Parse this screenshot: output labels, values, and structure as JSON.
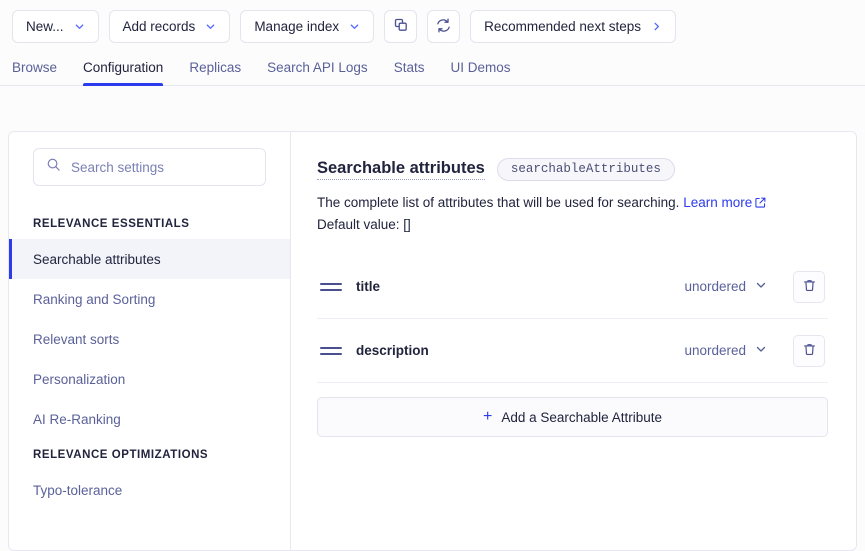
{
  "toolbar": {
    "buttons": [
      {
        "label": "New...",
        "icon": "chevron-down-icon",
        "type": "dropdown"
      },
      {
        "label": "Add records",
        "icon": "chevron-down-icon",
        "type": "dropdown"
      },
      {
        "label": "Manage index",
        "icon": "chevron-down-icon",
        "type": "dropdown"
      }
    ],
    "icon_buttons": [
      {
        "name": "copy-index-icon",
        "title": "Copy"
      },
      {
        "name": "refresh-icon",
        "title": "Refresh"
      }
    ],
    "recommended": {
      "label": "Recommended next steps",
      "icon": "chevron-right-icon"
    }
  },
  "tabs": [
    {
      "label": "Browse",
      "active": false
    },
    {
      "label": "Configuration",
      "active": true
    },
    {
      "label": "Replicas",
      "active": false
    },
    {
      "label": "Search API Logs",
      "active": false
    },
    {
      "label": "Stats",
      "active": false
    },
    {
      "label": "UI Demos",
      "active": false
    }
  ],
  "sidebar": {
    "search": {
      "placeholder": "Search settings",
      "value": "",
      "icon": "search-icon"
    },
    "groups": [
      {
        "heading": "RELEVANCE ESSENTIALS",
        "items": [
          {
            "label": "Searchable attributes",
            "active": true
          },
          {
            "label": "Ranking and Sorting",
            "active": false
          },
          {
            "label": "Relevant sorts",
            "active": false
          },
          {
            "label": "Personalization",
            "active": false
          },
          {
            "label": "AI Re-Ranking",
            "active": false
          }
        ]
      },
      {
        "heading": "RELEVANCE OPTIMIZATIONS",
        "items": [
          {
            "label": "Typo-tolerance",
            "active": false
          }
        ]
      }
    ]
  },
  "content": {
    "title": "Searchable attributes",
    "badge": "searchableAttributes",
    "description": "The complete list of attributes that will be used for searching.",
    "learn_more": "Learn more",
    "default_value": "Default value: []",
    "attributes": [
      {
        "name": "title",
        "ordering": "unordered"
      },
      {
        "name": "description",
        "ordering": "unordered"
      }
    ],
    "add_button": "Add a Searchable Attribute"
  },
  "colors": {
    "accent": "#2c3bec",
    "link": "#2c3bec",
    "text": "#21243d",
    "muted": "#5a6199",
    "border": "#e7e7f0",
    "active_bg": "#f3f3fa"
  }
}
